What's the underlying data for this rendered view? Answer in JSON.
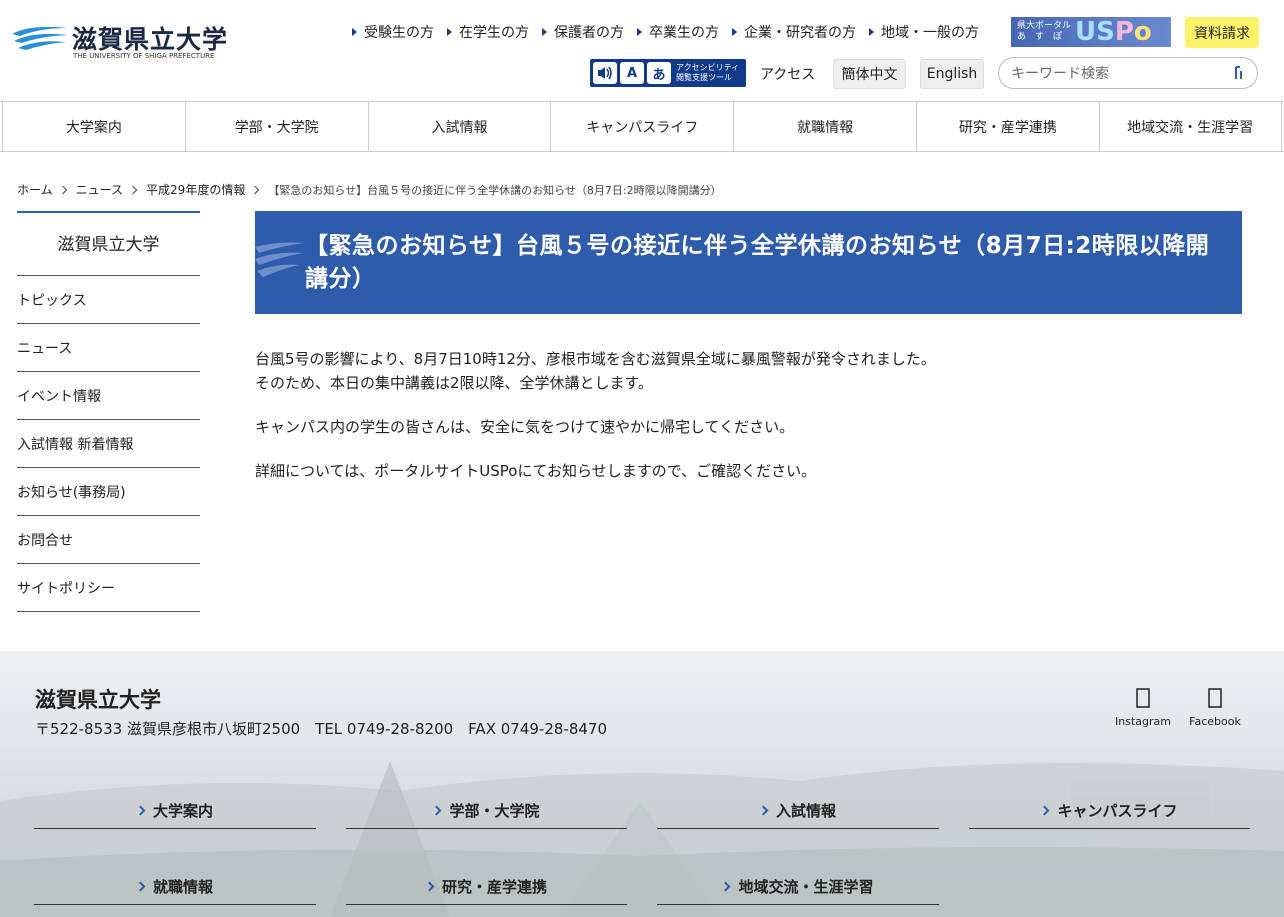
{
  "header": {
    "logo_name": "滋賀県立大学",
    "logo_en": "THE UNIVERSITY OF SHIGA PREFECTURE",
    "top_links": [
      "受験生の方",
      "在学生の方",
      "保護者の方",
      "卒業生の方",
      "企業・研究者の方",
      "地域・一般の方"
    ],
    "uspo": {
      "sub": "県大ポータル\nあ　す　ぽ",
      "logo_u": "U",
      "logo_s": "S",
      "logo_p": "P",
      "logo_o": "o"
    },
    "shiryo_label": "資料請求",
    "access_tool_label": "アクセシビリティ\n閲覧支援ツール",
    "access_link": "アクセス",
    "lang_zh": "簡体中文",
    "lang_en": "English",
    "search_placeholder": "キーワード検索"
  },
  "gnav": [
    "大学案内",
    "学部・大学院",
    "入試情報",
    "キャンパスライフ",
    "就職情報",
    "研究・産学連携",
    "地域交流・生涯学習"
  ],
  "breadcrumb": {
    "items": [
      "ホーム",
      "ニュース",
      "平成29年度の情報"
    ],
    "current": "【緊急のお知らせ】台風５号の接近に伴う全学休講のお知らせ（8月7日:2時限以降開講分）"
  },
  "sidenav": {
    "title": "滋賀県立大学",
    "items": [
      "トピックス",
      "ニュース",
      "イベント情報",
      "入試情報 新着情報",
      "お知らせ(事務局)",
      "お問合せ",
      "サイトポリシー"
    ]
  },
  "main": {
    "title": "【緊急のお知らせ】台風５号の接近に伴う全学休講のお知らせ（8月7日:2時限以降開講分）",
    "paragraphs": [
      [
        "台風5号の影響により、8月7日10時12分、彦根市域を含む滋賀県全域に暴風警報が発令されました。",
        "そのため、本日の集中講義は2限以降、全学休講とします。"
      ],
      [
        "キャンパス内の学生の皆さんは、安全に気をつけて速やかに帰宅してください。"
      ],
      [
        "詳細については、ポータルサイトUSPoにてお知らせしますので、ご確認ください。"
      ]
    ]
  },
  "footer": {
    "name": "滋賀県立大学",
    "address": "〒522-8533 滋賀県彦根市八坂町2500　TEL 0749-28-8200　FAX 0749-28-8470",
    "sns": [
      {
        "label": "Instagram",
        "icon": "instagram-icon"
      },
      {
        "label": "Facebook",
        "icon": "facebook-icon"
      }
    ],
    "nav": [
      "大学案内",
      "学部・大学院",
      "入試情報",
      "キャンパスライフ",
      "就職情報",
      "研究・産学連携",
      "地域交流・生涯学習"
    ]
  },
  "colors": {
    "brand_blue": "#2f5bab",
    "accent_yellow": "#fcf36a",
    "access_tool_bg": "#123a8a"
  }
}
